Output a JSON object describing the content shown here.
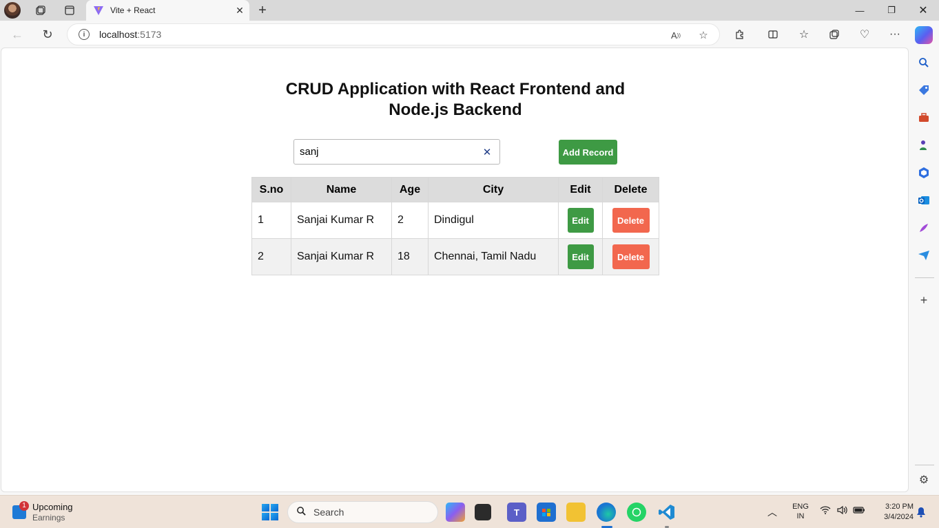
{
  "browser": {
    "tab_title": "Vite + React",
    "url_host": "localhost",
    "url_port": ":5173",
    "copilot_colors": [
      "#2fb7f5",
      "#5b5ef0",
      "#e455a6"
    ]
  },
  "page": {
    "title_line1": "CRUD Application with React Frontend and",
    "title_line2": "Node.js Backend",
    "search_value": "sanj",
    "search_clear_label": "✕",
    "add_record_label": "Add Record",
    "accent_green": "#3e9a44",
    "accent_red": "#f2674e"
  },
  "table": {
    "headers": [
      "S.no",
      "Name",
      "Age",
      "City",
      "Edit",
      "Delete"
    ],
    "rows": [
      {
        "sno": "1",
        "name": "Sanjai Kumar R",
        "age": "2",
        "city": "Dindigul",
        "edit": "Edit",
        "delete": "Delete"
      },
      {
        "sno": "2",
        "name": "Sanjai Kumar R",
        "age": "18",
        "city": "Chennai, Tamil Nadu",
        "edit": "Edit",
        "delete": "Delete"
      }
    ]
  },
  "taskbar": {
    "widget_badge": "1",
    "widget_title": "Upcoming",
    "widget_subtitle": "Earnings",
    "search_label": "Search",
    "lang_line1": "ENG",
    "lang_line2": "IN",
    "time": "3:20 PM",
    "date": "3/4/2024"
  }
}
